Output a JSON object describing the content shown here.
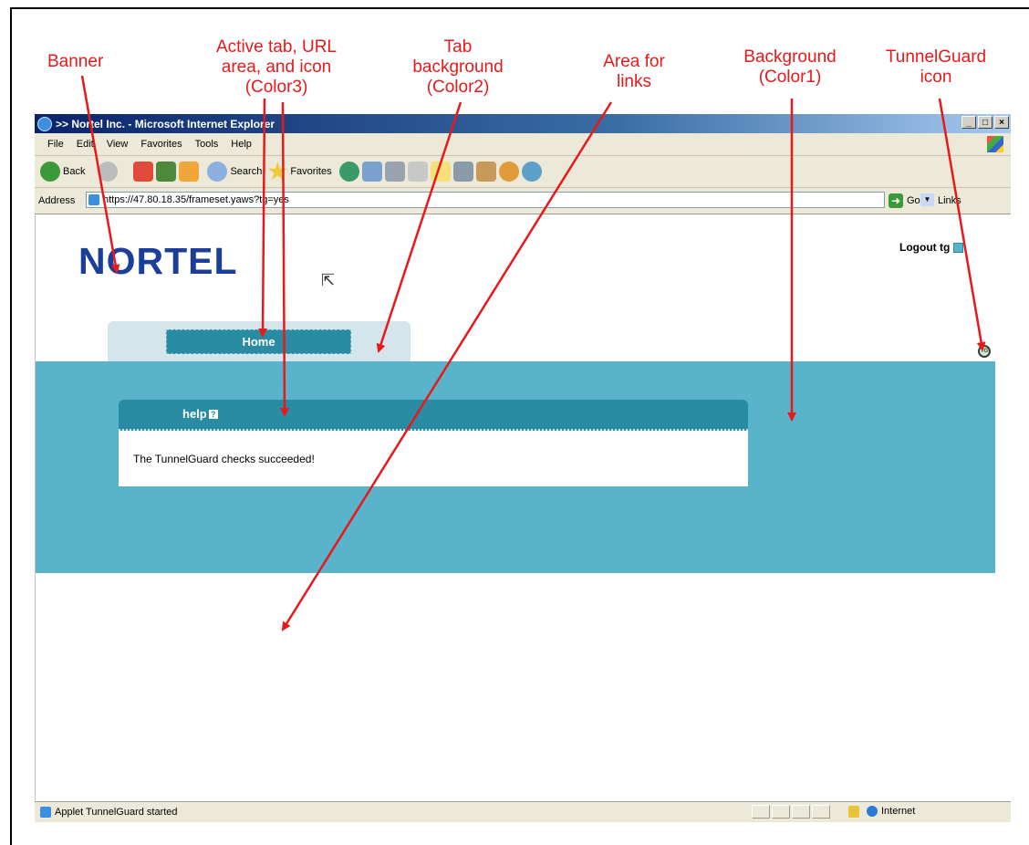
{
  "annotations": {
    "banner": "Banner",
    "active_tab": "Active tab, URL\narea, and icon\n(Color3)",
    "tab_background": "Tab\nbackground\n(Color2)",
    "area_for_links": "Area for\nlinks",
    "background": "Background\n(Color1)",
    "tunnelguard_icon": "TunnelGuard\nicon",
    "color": "#e8191a"
  },
  "window": {
    "title": ">> Nortel Inc. - Microsoft Internet Explorer",
    "controls": [
      "_",
      "×"
    ]
  },
  "menu": [
    "File",
    "Edit",
    "View",
    "Favorites",
    "Tools",
    "Help"
  ],
  "toolbar": {
    "back": "Back",
    "search": "Search",
    "favorites": "Favorites"
  },
  "address": {
    "label": "Address",
    "url": "https://47.80.18.35/frameset.yaws?tg=yes",
    "go": "Go",
    "links": "Links"
  },
  "page": {
    "logo": "NORTEL",
    "logout": "Logout tg",
    "tab_home": "Home",
    "panel_title": "help",
    "message": "The TunnelGuard checks succeeded!",
    "tg_icon_label": "TG",
    "colors": {
      "color1_background": "#59b3cb",
      "color2_tab_background": "#d4e6ec",
      "color3_active": "#2a8ca2"
    }
  },
  "status": {
    "text": "Applet TunnelGuard started",
    "zone": "Internet"
  }
}
